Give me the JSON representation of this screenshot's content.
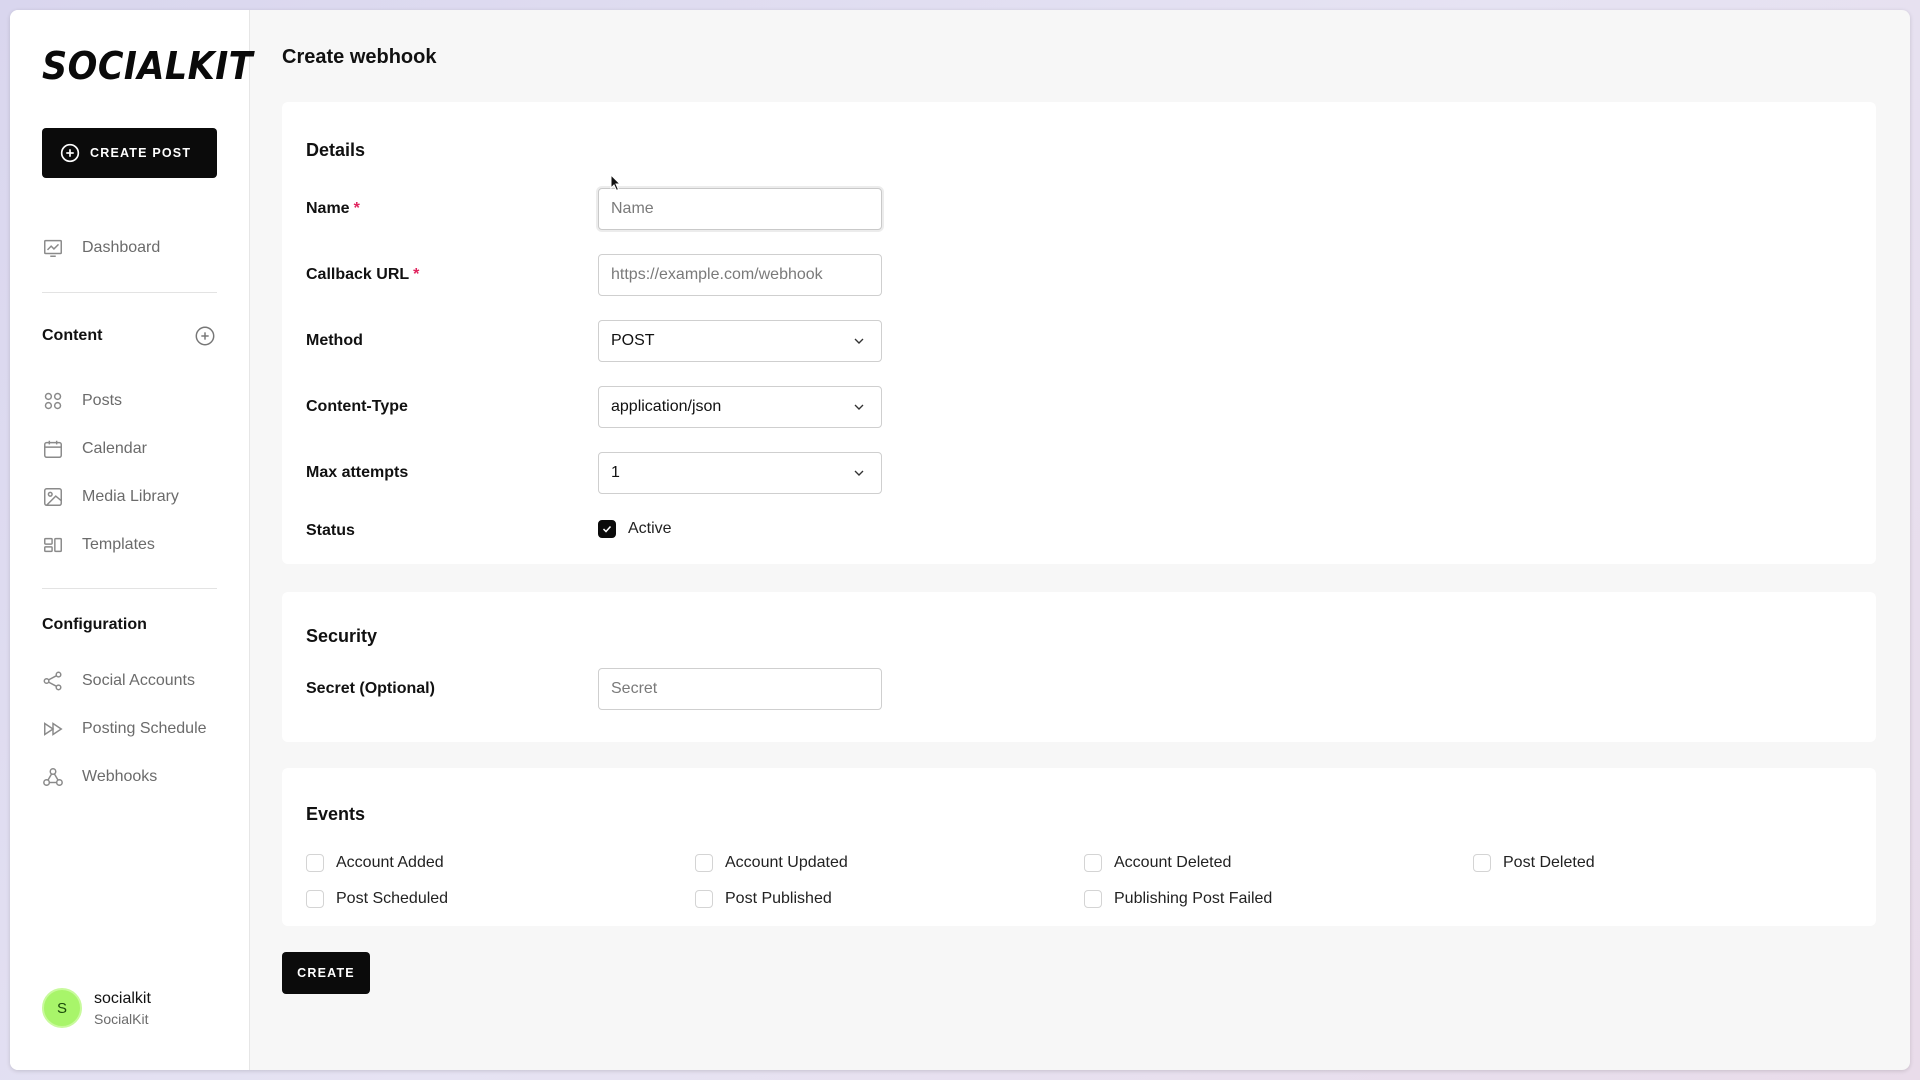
{
  "sidebar": {
    "logo": "SOCIALKIT",
    "create_post_label": "CREATE POST",
    "dashboard_label": "Dashboard",
    "content_heading": "Content",
    "content_items": [
      {
        "label": "Posts",
        "icon": "grid-icon"
      },
      {
        "label": "Calendar",
        "icon": "calendar-icon"
      },
      {
        "label": "Media Library",
        "icon": "image-icon"
      },
      {
        "label": "Templates",
        "icon": "templates-icon"
      }
    ],
    "configuration_heading": "Configuration",
    "configuration_items": [
      {
        "label": "Social Accounts",
        "icon": "share-icon"
      },
      {
        "label": "Posting Schedule",
        "icon": "fast-forward-icon"
      },
      {
        "label": "Webhooks",
        "icon": "webhook-icon"
      }
    ],
    "user": {
      "initial": "S",
      "name": "socialkit",
      "org": "SocialKit"
    }
  },
  "main": {
    "title": "Create webhook",
    "details": {
      "title": "Details",
      "name_label": "Name",
      "name_placeholder": "Name",
      "callback_label": "Callback URL",
      "callback_placeholder": "https://example.com/webhook",
      "method_label": "Method",
      "method_value": "POST",
      "content_type_label": "Content-Type",
      "content_type_value": "application/json",
      "max_attempts_label": "Max attempts",
      "max_attempts_value": "1",
      "status_label": "Status",
      "status_option": "Active",
      "status_checked": true,
      "required_mark": "*"
    },
    "security": {
      "title": "Security",
      "secret_label": "Secret (Optional)",
      "secret_placeholder": "Secret"
    },
    "events": {
      "title": "Events",
      "items": [
        {
          "label": "Account Added",
          "checked": false
        },
        {
          "label": "Account Updated",
          "checked": false
        },
        {
          "label": "Account Deleted",
          "checked": false
        },
        {
          "label": "Post Deleted",
          "checked": false
        },
        {
          "label": "Post Scheduled",
          "checked": false
        },
        {
          "label": "Post Published",
          "checked": false
        },
        {
          "label": "Publishing Post Failed",
          "checked": false
        }
      ]
    },
    "create_label": "CREATE"
  },
  "colors": {
    "accent": "#0b0b0b",
    "required": "#e0245e",
    "avatar": "#a8f56a",
    "background": "#f7f7f7"
  }
}
